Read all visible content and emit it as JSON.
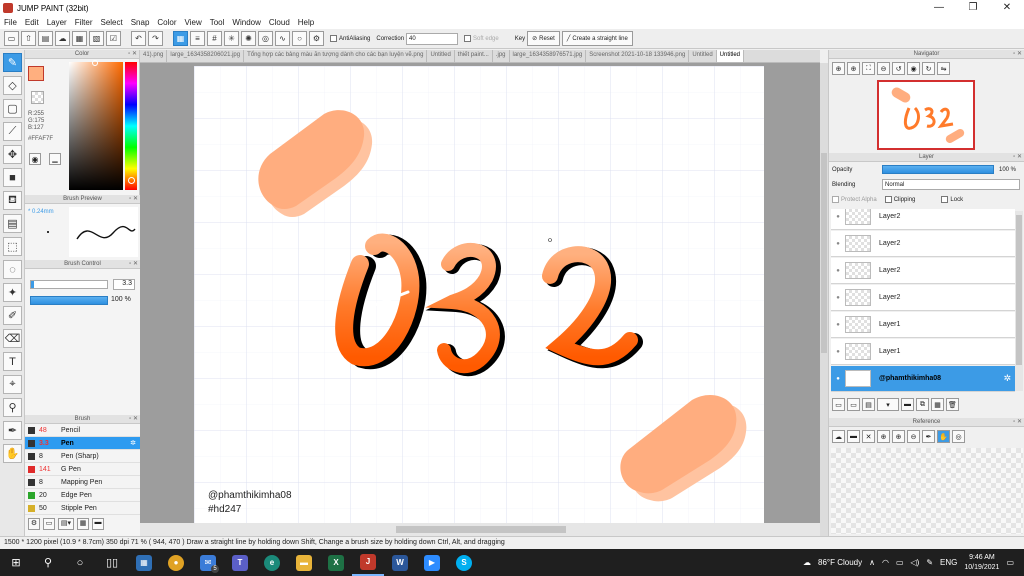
{
  "window": {
    "title": "JUMP PAINT (32bit)",
    "min": "—",
    "max": "❐",
    "close": "✕"
  },
  "menu": [
    "File",
    "Edit",
    "Layer",
    "Filter",
    "Select",
    "Snap",
    "Color",
    "View",
    "Tool",
    "Window",
    "Cloud",
    "Help"
  ],
  "toolbar": {
    "antialiasing": "AntiAliasing",
    "correction_label": "Correction",
    "correction_value": "40",
    "soft_edge": "Soft edge",
    "key_label": "Key",
    "reset": "Reset",
    "straight_line": "Create a straight line"
  },
  "color_panel": {
    "title": "Color",
    "r": "R:255",
    "g": "G:175",
    "b": "B:127",
    "hex": "#FFAF7F",
    "main_color": "#FFAF7F"
  },
  "brush_preview": {
    "title": "Brush Preview",
    "size": "* 0.24mm"
  },
  "brush_control": {
    "title": "Brush Control",
    "size_value": "3.3",
    "opacity_value": "100 %"
  },
  "brush_list": {
    "title": "Brush",
    "items": [
      {
        "size": "48",
        "name": "Pencil",
        "color": "#333333"
      },
      {
        "size": "3.3",
        "name": "Pen",
        "color": "#333333"
      },
      {
        "size": "8",
        "name": "Pen (Sharp)",
        "color": "#333333"
      },
      {
        "size": "141",
        "name": "G Pen",
        "color": "#e02b2b"
      },
      {
        "size": "8",
        "name": "Mapping Pen",
        "color": "#333333"
      },
      {
        "size": "20",
        "name": "Edge Pen",
        "color": "#2aa52a"
      },
      {
        "size": "50",
        "name": "Stipple Pen",
        "color": "#d6b02a"
      }
    ]
  },
  "tabs": [
    "41).png",
    "large_1634358206021.jpg",
    "Tổng hợp các bảng màu ăn tượng dành cho các bạn luyện vẽ.png",
    "Untitled",
    "thiết paint...",
    ".jpg",
    "large_1634358976571.jpg",
    "Screenshot 2021-10-18 133946.png",
    "Untitled",
    "Untitled"
  ],
  "canvas": {
    "text_display": "032",
    "watermark_user": "@phamthikimha08",
    "watermark_tag": "#hd247"
  },
  "navigator": {
    "title": "Navigator"
  },
  "layer_panel": {
    "title": "Layer",
    "opacity_label": "Opacity",
    "opacity_value": "100 %",
    "blending_label": "Blending",
    "blending_value": "Normal",
    "protect_alpha": "Protect Alpha",
    "clipping": "Clipping",
    "lock": "Lock",
    "layers": [
      {
        "name": "Layer2"
      },
      {
        "name": "Layer2"
      },
      {
        "name": "Layer2"
      },
      {
        "name": "Layer2"
      },
      {
        "name": "Layer1"
      },
      {
        "name": "Layer1"
      },
      {
        "name": "@phamthikimha08"
      }
    ]
  },
  "reference_panel": {
    "title": "Reference"
  },
  "statusbar": {
    "text": "1500 * 1200 pixel   (10.9 * 8.7cm)   350 dpi   71 %   ( 944, 470 )   Draw a straight line by holding down Shift, Change a brush size by holding down Ctrl, Alt, and dragging"
  },
  "taskbar": {
    "weather": "86°F  Cloudy",
    "lang": "ENG",
    "time": "9:46 AM",
    "date": "10/19/2021",
    "mail_badge": "5"
  }
}
